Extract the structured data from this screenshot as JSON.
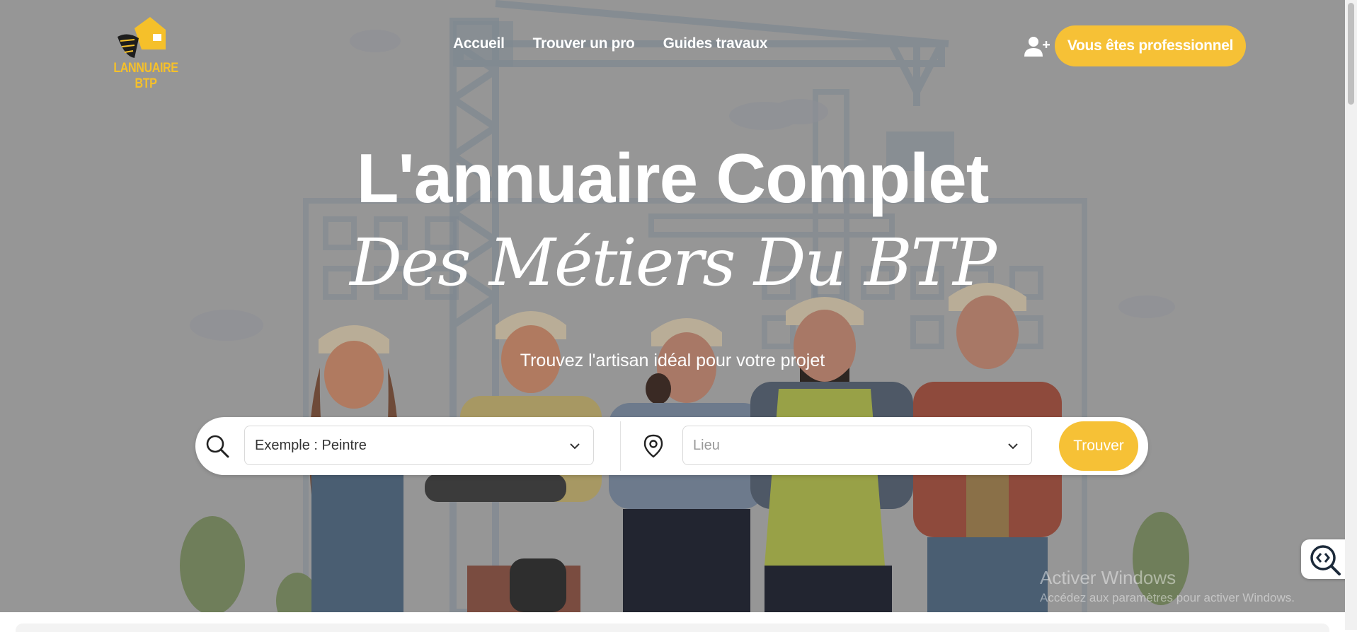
{
  "logo": {
    "text": "LANNUAIRE BTP"
  },
  "nav": {
    "items": [
      {
        "label": "Accueil"
      },
      {
        "label": "Trouver un pro"
      },
      {
        "label": "Guides travaux"
      }
    ],
    "pro_button": "Vous êtes professionnel"
  },
  "hero": {
    "title": "L'annuaire Complet",
    "title_script": "Des Métiers Du BTP",
    "subtitle": "Trouvez l'artisan idéal pour votre projet"
  },
  "search": {
    "trade_value": "Exemple : Peintre",
    "location_placeholder": "Lieu",
    "submit_label": "Trouver"
  },
  "watermark": {
    "line1": "Activer Windows",
    "line2": "Accédez aux paramètres pour activer Windows."
  },
  "colors": {
    "accent": "#f6c136",
    "overlay": "#969696"
  },
  "icons": [
    "user-plus-icon",
    "search-icon",
    "location-pin-icon",
    "chevron-down-icon",
    "accessibility-icon"
  ]
}
